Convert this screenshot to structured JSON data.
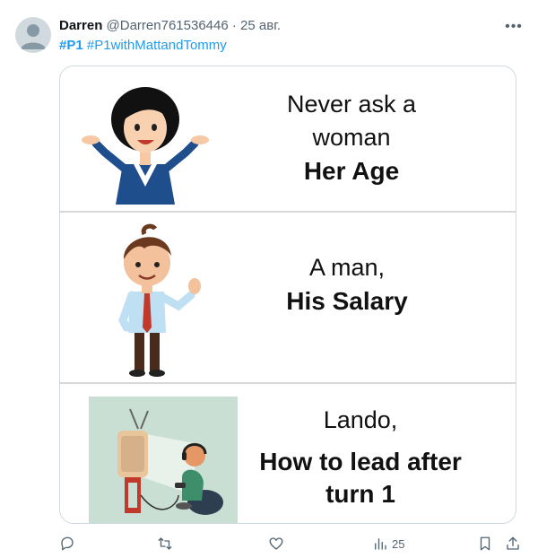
{
  "tweet": {
    "author_name": "Darren",
    "author_handle": "@Darren761536446",
    "dot": "·",
    "date": "25 авг.",
    "hashtags": [
      "#P1",
      "#P1withMattandTommy"
    ]
  },
  "meme": {
    "panel1": {
      "line1": "Never ask a",
      "line2": "woman",
      "emphasis": "Her Age"
    },
    "panel2": {
      "line1": "A man,",
      "emphasis": "His Salary"
    },
    "panel3": {
      "line1": "Lando,",
      "emphasis": "How to lead after turn 1"
    }
  },
  "actions": {
    "reply_icon": "reply-icon",
    "retweet_icon": "retweet-icon",
    "like_icon": "heart-icon",
    "views_icon": "views-icon",
    "views_count": "25",
    "bookmark_icon": "bookmark-icon",
    "share_icon": "share-icon"
  },
  "colors": {
    "link": "#1d9bf0",
    "muted": "#536471",
    "text": "#0f1419",
    "border": "#cfd9de"
  }
}
